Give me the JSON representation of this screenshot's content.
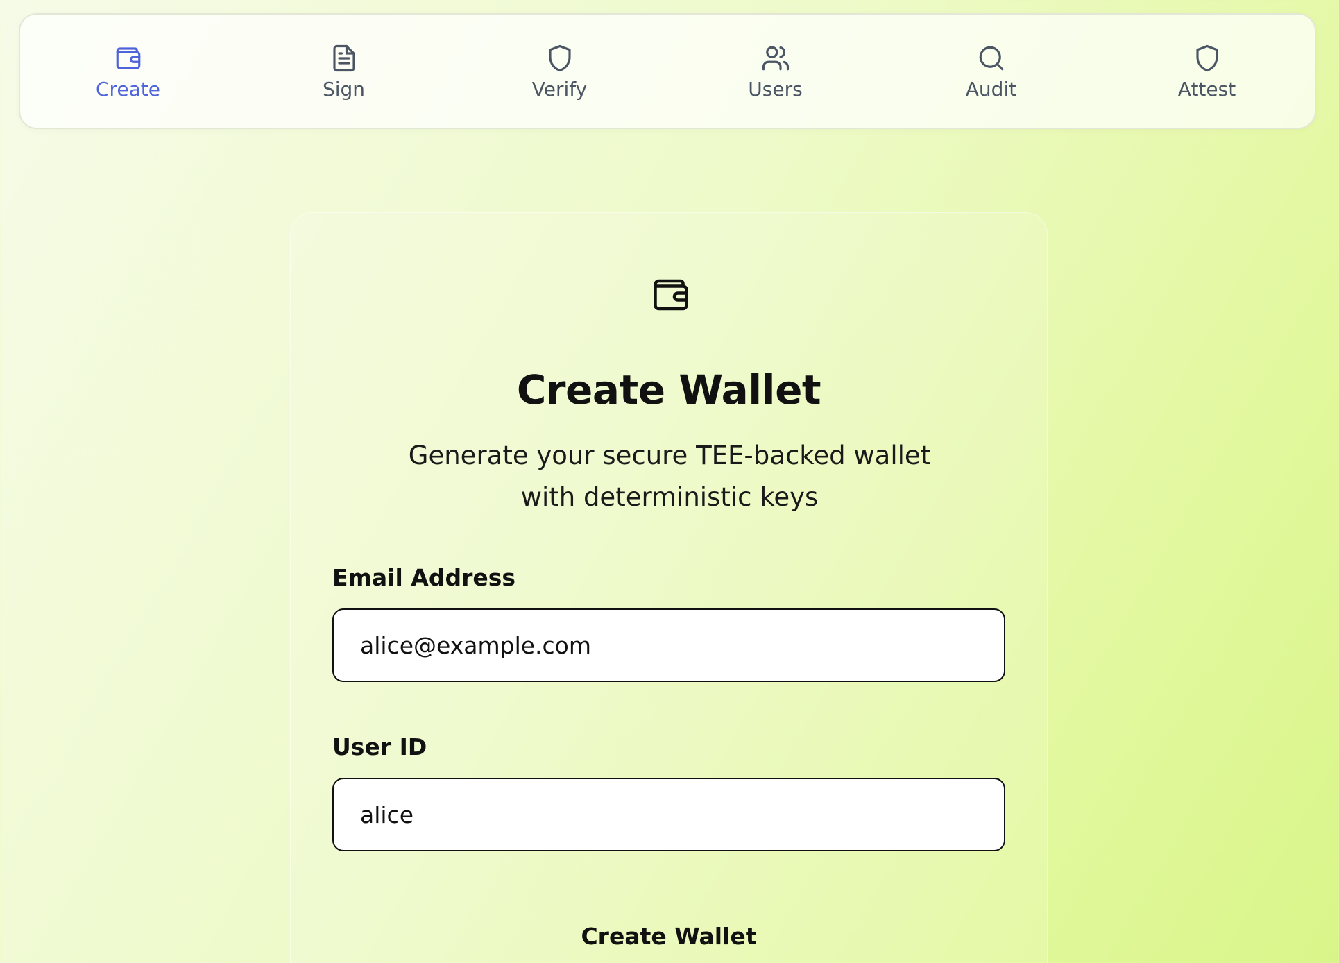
{
  "nav": {
    "items": [
      {
        "label": "Create",
        "icon": "wallet-icon",
        "active": true
      },
      {
        "label": "Sign",
        "icon": "document-icon",
        "active": false
      },
      {
        "label": "Verify",
        "icon": "shield-icon",
        "active": false
      },
      {
        "label": "Users",
        "icon": "users-icon",
        "active": false
      },
      {
        "label": "Audit",
        "icon": "search-icon",
        "active": false
      },
      {
        "label": "Attest",
        "icon": "shield-icon",
        "active": false
      }
    ]
  },
  "colors": {
    "active": "#4f63db",
    "inactive": "#4b5563",
    "background_start": "#f6fbe8",
    "background_end": "#d9f589"
  },
  "form": {
    "icon": "wallet-icon",
    "title": "Create Wallet",
    "subtitle": "Generate your secure TEE-backed wallet with deterministic keys",
    "email_label": "Email Address",
    "email_value": "alice@example.com",
    "userid_label": "User ID",
    "userid_value": "alice",
    "submit_label": "Create Wallet"
  }
}
